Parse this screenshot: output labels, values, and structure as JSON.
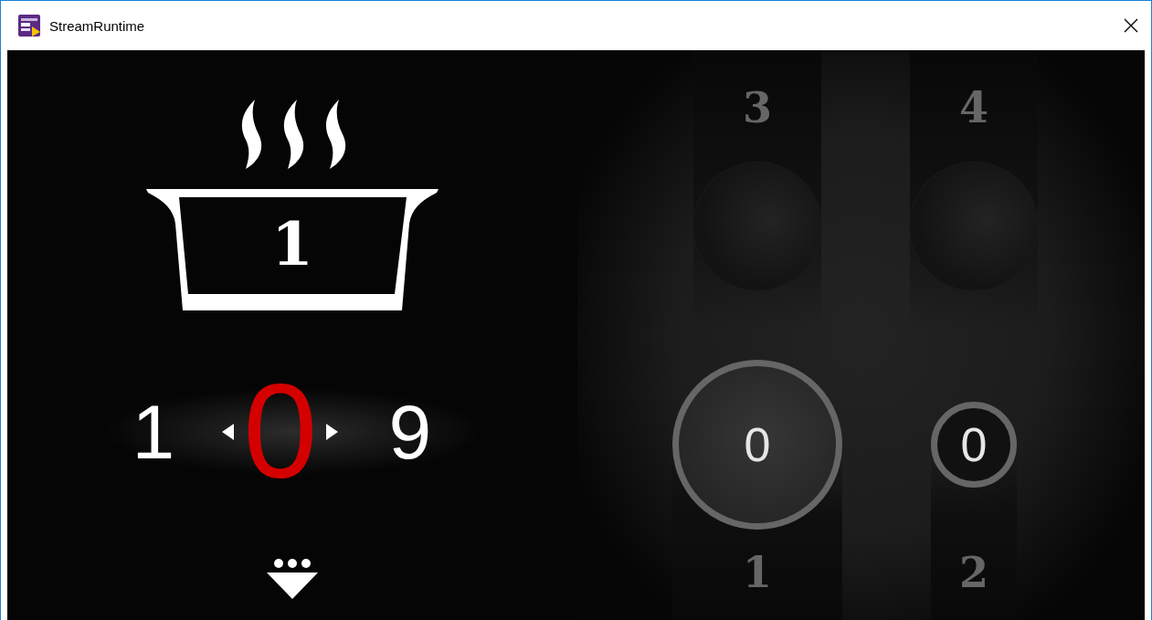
{
  "window": {
    "title": "StreamRuntime"
  },
  "pot": {
    "number": "1"
  },
  "power_selector": {
    "previous": "1",
    "value": "0",
    "next": "9"
  },
  "burners": [
    {
      "label": "3",
      "kind": "disc",
      "selected": false
    },
    {
      "label": "4",
      "kind": "disc",
      "selected": false
    },
    {
      "label": "1",
      "kind": "ring",
      "value": "0",
      "selected": true
    },
    {
      "label": "2",
      "kind": "ring",
      "value": "0",
      "selected": false
    }
  ]
}
